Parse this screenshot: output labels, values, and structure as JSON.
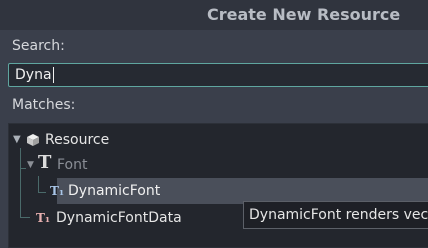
{
  "dialog": {
    "title": "Create New Resource"
  },
  "search": {
    "label": "Search:",
    "value": "Dyna"
  },
  "matches": {
    "label": "Matches:"
  },
  "tree": {
    "items": [
      {
        "label": "Resource",
        "icon": "resource-cube-icon"
      },
      {
        "label": "Font",
        "icon": "font-icon"
      },
      {
        "label": "DynamicFont",
        "icon": "dynamic-font-icon",
        "selected": true
      },
      {
        "label": "DynamicFontData",
        "icon": "dynamic-font-data-icon"
      }
    ]
  },
  "tooltip": {
    "text": "DynamicFont renders vector"
  },
  "colors": {
    "accent": "#5fa6a0",
    "dialog_bg": "#3a3f4b",
    "tree_bg": "#23262d",
    "selection": "#4a4f5a"
  }
}
